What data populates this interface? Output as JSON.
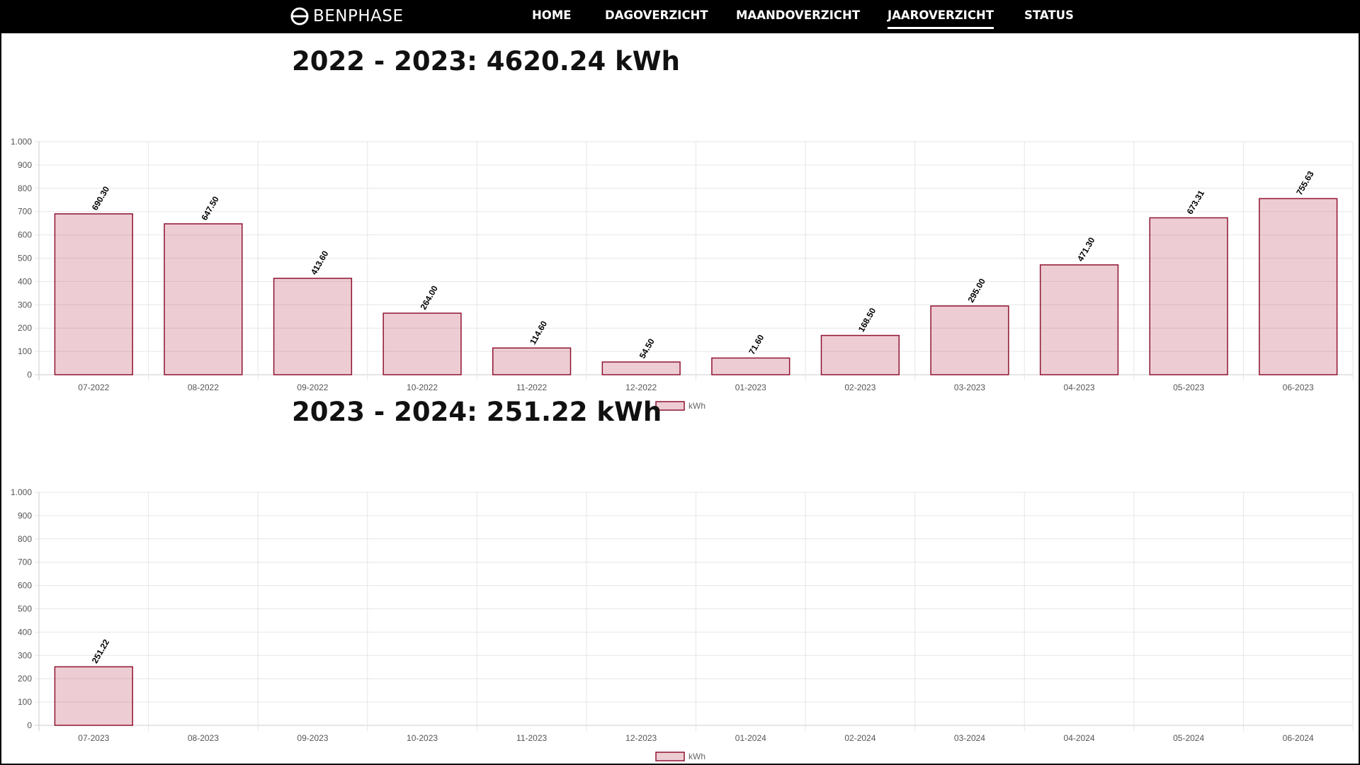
{
  "nav": {
    "brand": "BENPHASE",
    "items": [
      {
        "label": "HOME",
        "active": false
      },
      {
        "label": "DAGOVERZICHT",
        "active": false
      },
      {
        "label": "MAANDOVERZICHT",
        "active": false
      },
      {
        "label": "JAAROVERZICHT",
        "active": true
      },
      {
        "label": "STATUS",
        "active": false
      }
    ]
  },
  "sections": [
    {
      "title": "2022 - 2023: 4620.24 kWh"
    },
    {
      "title": "2023 - 2024: 251.22 kWh"
    }
  ],
  "colors": {
    "bar_fill": "rgba(201,103,122,0.33)",
    "bar_border": "#8f1331",
    "navbar": "#000000"
  },
  "chart_data": [
    {
      "type": "bar",
      "categories": [
        "07-2022",
        "08-2022",
        "09-2022",
        "10-2022",
        "11-2022",
        "12-2022",
        "01-2023",
        "02-2023",
        "03-2023",
        "04-2023",
        "05-2023",
        "06-2023"
      ],
      "series": [
        {
          "name": "kWh",
          "values": [
            690.3,
            647.5,
            413.6,
            264.0,
            114.6,
            54.5,
            71.6,
            168.5,
            295.0,
            471.3,
            673.31,
            755.63
          ]
        }
      ],
      "data_labels": [
        "690.30",
        "647.50",
        "413.60",
        "264.00",
        "114.60",
        "54.50",
        "71.60",
        "168.50",
        "295.00",
        "471.30",
        "673.31",
        "755.63"
      ],
      "yticks": [
        "0",
        "100",
        "200",
        "300",
        "400",
        "500",
        "600",
        "700",
        "800",
        "900",
        "1.000"
      ],
      "ylim": [
        0,
        1000
      ],
      "grid": true,
      "legend": "bottom"
    },
    {
      "type": "bar",
      "categories": [
        "07-2023",
        "08-2023",
        "09-2023",
        "10-2023",
        "11-2023",
        "12-2023",
        "01-2024",
        "02-2024",
        "03-2024",
        "04-2024",
        "05-2024",
        "06-2024"
      ],
      "series": [
        {
          "name": "kWh",
          "values": [
            251.22,
            null,
            null,
            null,
            null,
            null,
            null,
            null,
            null,
            null,
            null,
            null
          ]
        }
      ],
      "data_labels": [
        "251.22",
        "",
        "",
        "",
        "",
        "",
        "",
        "",
        "",
        "",
        "",
        ""
      ],
      "yticks": [
        "0",
        "100",
        "200",
        "300",
        "400",
        "500",
        "600",
        "700",
        "800",
        "900",
        "1.000"
      ],
      "ylim": [
        0,
        1000
      ],
      "grid": true,
      "legend": "bottom"
    }
  ]
}
